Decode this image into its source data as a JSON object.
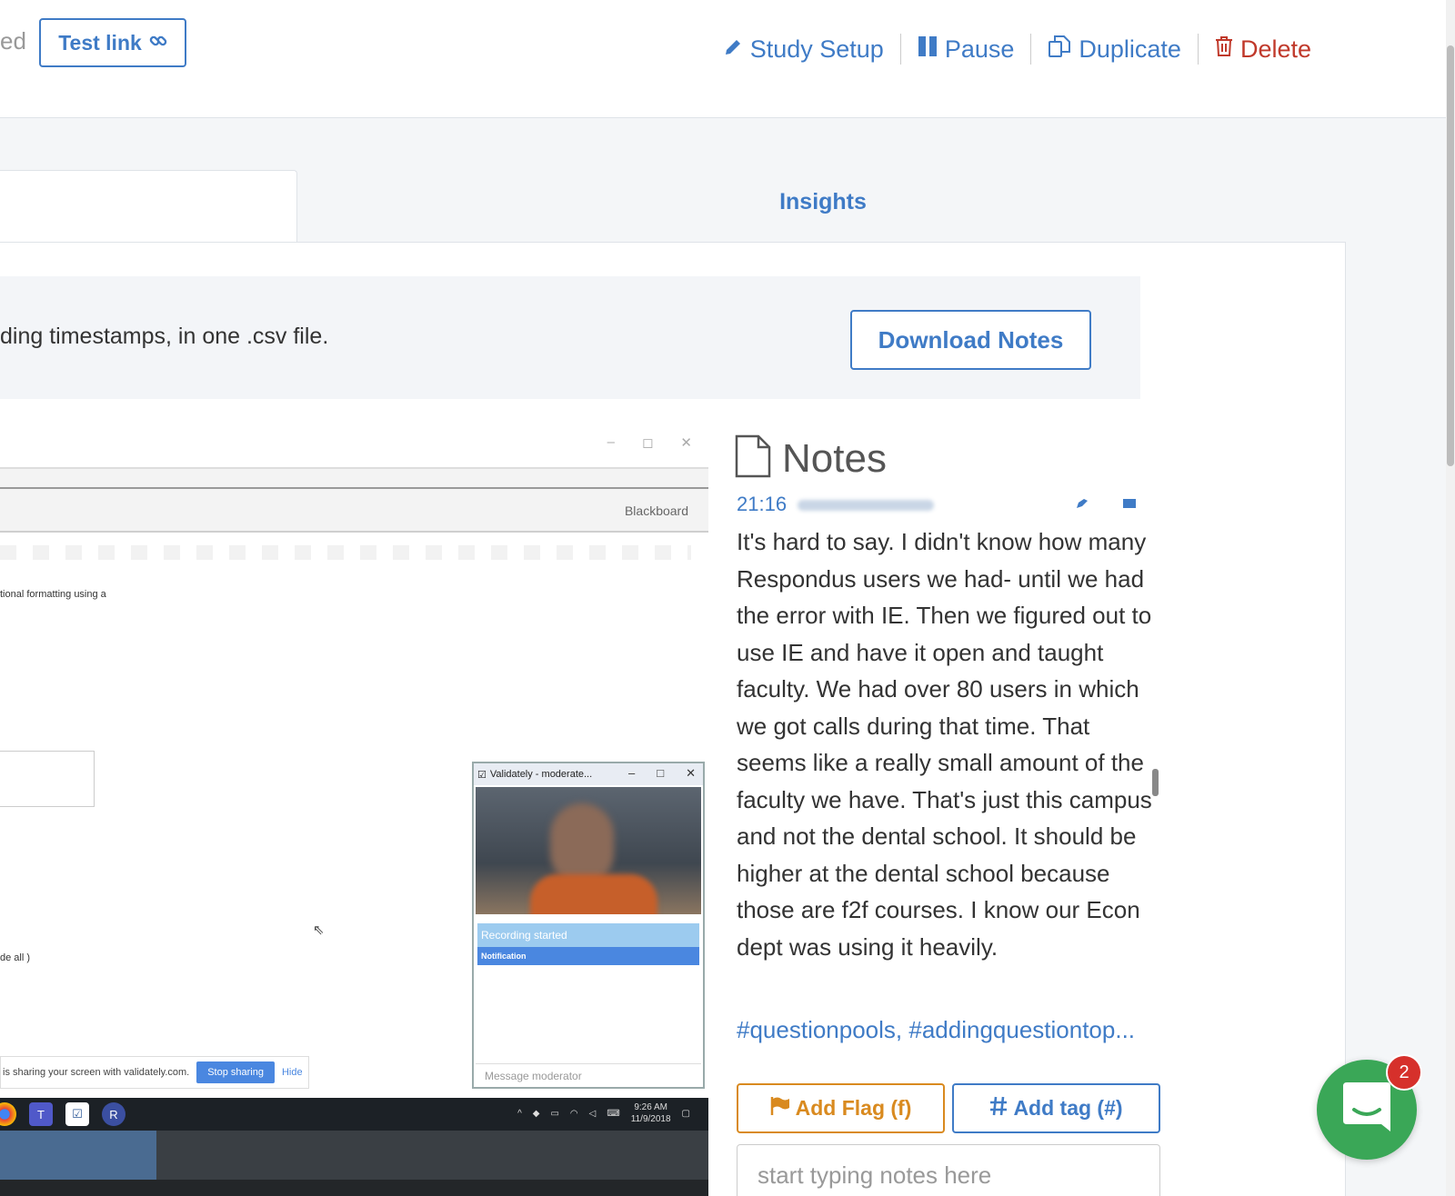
{
  "header": {
    "status_fragment": "ed",
    "test_link": "Test link",
    "actions": {
      "study_setup": "Study Setup",
      "pause": "Pause",
      "duplicate": "Duplicate",
      "delete": "Delete"
    }
  },
  "tabs": {
    "insights": "Insights"
  },
  "info_bar": {
    "text": "ding timestamps, in one .csv file.",
    "download_button": "Download Notes"
  },
  "video": {
    "browser_label": "Blackboard",
    "content_line_1": "tional formatting using a",
    "content_line_2": "de all )",
    "share_text": "is sharing your screen with validately.com.",
    "stop_sharing": "Stop sharing",
    "hide": "Hide",
    "moderator_window": {
      "title": "Validately - moderate...",
      "recording": "Recording started",
      "notification": "Notification",
      "message_placeholder": "Message moderator"
    },
    "taskbar": {
      "time": "9:26 AM",
      "date": "11/9/2018"
    }
  },
  "notes": {
    "title": "Notes",
    "timestamp": "21:16",
    "body": "It's hard to say. I didn't know how many Respondus users we had- until we had the error with IE. Then we figured out to use IE and have it open and taught faculty. We had over 80 users in which we got calls during that time. That seems like a really small amount of the faculty we have. That's just this campus and not the dental school. It should be higher at the dental school because those are f2f courses. I know our Econ dept was using it heavily.",
    "tags": "#questionpools, #addingquestiontop...",
    "add_flag": "Add Flag (f)",
    "add_tag": "Add tag (#)",
    "input_placeholder": "start typing notes here"
  },
  "chat": {
    "badge_count": "2"
  },
  "colors": {
    "primary": "#3f7bc6",
    "danger": "#c0392b",
    "flag": "#d98a1f",
    "chat": "#3aa757",
    "badge": "#d6302b"
  }
}
